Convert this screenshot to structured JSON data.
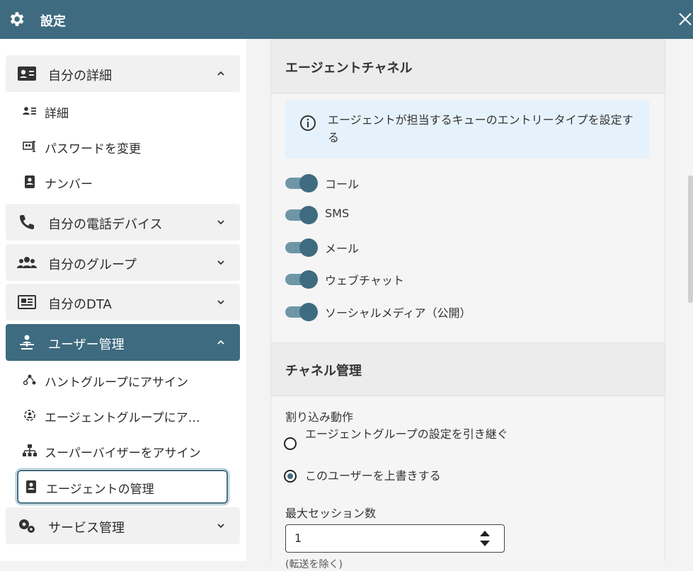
{
  "window": {
    "title": "設定"
  },
  "sidebar": {
    "sections": [
      {
        "label": "自分の詳細",
        "icon": "contact-card-icon",
        "expanded": true
      },
      {
        "label": "自分の電話デバイス",
        "icon": "phone-icon",
        "expanded": false
      },
      {
        "label": "自分のグループ",
        "icon": "group-icon",
        "expanded": false
      },
      {
        "label": "自分のDTA",
        "icon": "dta-card-icon",
        "expanded": false
      },
      {
        "label": "ユーザー管理",
        "icon": "user-management-icon",
        "expanded": true,
        "active": true
      },
      {
        "label": "サービス管理",
        "icon": "service-settings-icon",
        "expanded": false
      }
    ],
    "my_details_items": [
      {
        "label": "詳細",
        "icon": "details-icon"
      },
      {
        "label": "パスワードを変更",
        "icon": "password-icon"
      },
      {
        "label": "ナンバー",
        "icon": "number-icon"
      }
    ],
    "user_mgmt_items": [
      {
        "label": "ハントグループにアサイン",
        "icon": "hunt-group-icon"
      },
      {
        "label": "エージェントグループにア…",
        "icon": "agent-group-icon"
      },
      {
        "label": "スーパーバイザーをアサイン",
        "icon": "hierarchy-icon"
      },
      {
        "label": "エージェントの管理",
        "icon": "agent-manage-icon",
        "selected": true
      }
    ]
  },
  "main": {
    "agent_channel": {
      "title": "エージェントチャネル",
      "info": "エージェントが担当するキューのエントリータイプを設定する",
      "toggles": [
        {
          "label": "コール",
          "on": true
        },
        {
          "label": "SMS",
          "on": true
        },
        {
          "label": "メール",
          "on": true
        },
        {
          "label": "ウェブチャット",
          "on": true
        },
        {
          "label": "ソーシャルメディア（公開）",
          "on": true
        }
      ]
    },
    "channel_management": {
      "title": "チャネル管理",
      "interrupt_label": "割り込み動作",
      "options": [
        {
          "label": "エージェントグループの設定を引き継ぐ",
          "checked": false
        },
        {
          "label": "このユーザーを上書きする",
          "checked": true
        }
      ],
      "max_sessions_label": "最大セッション数",
      "max_sessions_value": "1",
      "cut_text": "(転送を除く)"
    }
  },
  "colors": {
    "primary": "#3e6b7f",
    "info_bg": "#e6f2fb"
  }
}
